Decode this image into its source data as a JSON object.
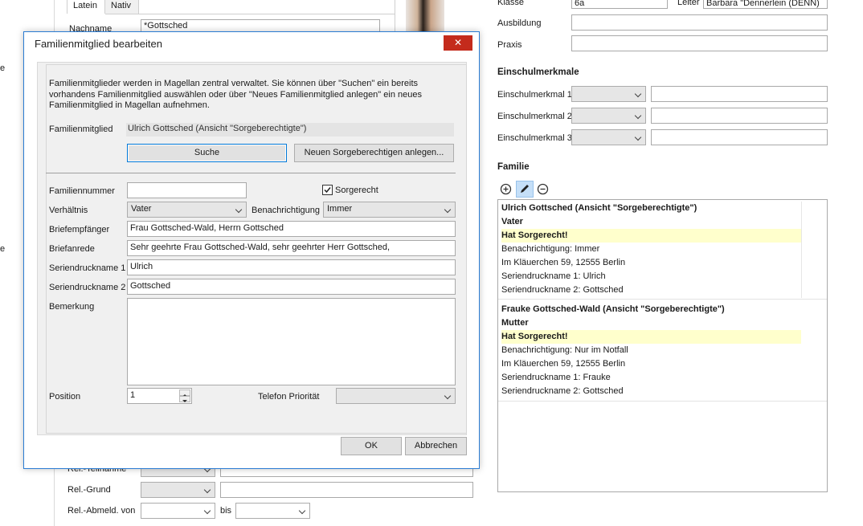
{
  "background": {
    "left_edge_labels": [
      "e",
      "e"
    ],
    "tabs": [
      "Latein",
      "Nativ"
    ],
    "nachname_label": "Nachname",
    "nachname_value": "*Gottsched",
    "rel_teilnahme_label": "Rel.-Teilnahme",
    "rel_grund_label": "Rel.-Grund",
    "rel_abmeld_label": "Rel.-Abmeld. von",
    "bis_label": "bis"
  },
  "right_panel": {
    "klasse_label": "Klasse",
    "klasse_value": "6a",
    "leiter_label": "Leiter",
    "leiter_value": "Barbara \"Dennerlein (DENN)",
    "ausbildung_label": "Ausbildung",
    "praxis_label": "Praxis",
    "einschul_title": "Einschulmerkmale",
    "einschul_labels": [
      "Einschulmerkmal 1",
      "Einschulmerkmal 2",
      "Einschulmerkmal 3"
    ],
    "familie_title": "Familie",
    "toolbar_icons": [
      "add-icon",
      "edit-icon",
      "remove-icon"
    ],
    "members": [
      {
        "name": "Ulrich Gottsched (Ansicht \"Sorgeberechtigte\")",
        "relation": "Vater",
        "sorgerecht": "Hat Sorgerecht!",
        "benachrichtigung": "Benachrichtigung: Immer",
        "address": "Im Kläuerchen 59, 12555 Berlin",
        "serien1": "Seriendruckname 1: Ulrich",
        "serien2": "Seriendruckname 2: Gottsched"
      },
      {
        "name": "Frauke Gottsched-Wald (Ansicht \"Sorgeberechtigte\")",
        "relation": "Mutter",
        "sorgerecht": "Hat Sorgerecht!",
        "benachrichtigung": "Benachrichtigung: Nur im Notfall",
        "address": "Im Kläuerchen 59, 12555 Berlin",
        "serien1": "Seriendruckname 1: Frauke",
        "serien2": "Seriendruckname 2: Gottsched"
      }
    ]
  },
  "dialog": {
    "title": "Familienmitglied bearbeiten",
    "close_glyph": "✕",
    "info_text": "Familienmitglieder werden in Magellan zentral verwaltet. Sie können über \"Suchen\" ein bereits vorhandens Familienmitglied auswählen oder über \"Neues Familienmitglied anlegen\" ein neues Familienmitglied in Magellan aufnehmen.",
    "familienmitglied_label": "Familienmitglied",
    "familienmitglied_value": "Ulrich Gottsched (Ansicht \"Sorgeberechtigte\")",
    "suche_button": "Suche",
    "neu_button": "Neuen Sorgeberechtigen anlegen...",
    "familiennummer_label": "Familiennummer",
    "familiennummer_value": "",
    "sorgerecht_label": "Sorgerecht",
    "sorgerecht_checked": true,
    "verhaeltnis_label": "Verhältnis",
    "verhaeltnis_value": "Vater",
    "benachrichtigung_label": "Benachrichtigung",
    "benachrichtigung_value": "Immer",
    "briefempfaenger_label": "Briefempfänger",
    "briefempfaenger_value": "Frau Gottsched-Wald, Herrn Gottsched",
    "briefanrede_label": "Briefanrede",
    "briefanrede_value": "Sehr geehrte Frau Gottsched-Wald, sehr geehrter Herr Gottsched,",
    "serien1_label": "Seriendruckname 1",
    "serien1_value": "Ulrich",
    "serien2_label": "Seriendruckname 2",
    "serien2_value": "Gottsched",
    "bemerkung_label": "Bemerkung",
    "bemerkung_value": "",
    "position_label": "Position",
    "position_value": "1",
    "telefon_label": "Telefon Priorität",
    "telefon_value": "",
    "ok_button": "OK",
    "abbrechen_button": "Abbrechen"
  }
}
